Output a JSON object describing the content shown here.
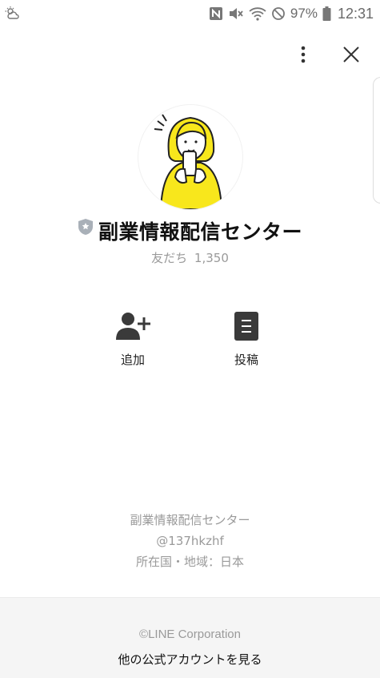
{
  "status_bar": {
    "battery": "97%",
    "time": "12:31",
    "icons": [
      "cloud-sun-icon",
      "nfc-icon",
      "mute-icon",
      "wifi-icon",
      "dnd-icon",
      "battery-icon"
    ]
  },
  "header": {
    "more_icon": "more-vertical-icon",
    "close_icon": "close-icon"
  },
  "profile": {
    "name": "副業情報配信センター",
    "badge_icon": "shield-badge-icon",
    "friends_label": "友だち",
    "friends_count": "1,350"
  },
  "actions": [
    {
      "label": "追加",
      "icon": "add-friend-icon"
    },
    {
      "label": "投稿",
      "icon": "post-icon"
    }
  ],
  "info": {
    "name": "副業情報配信センター",
    "id": "@137hkzhf",
    "region": "所在国・地域：日本"
  },
  "footer": {
    "copyright": "©LINE Corporation",
    "other_accounts": "他の公式アカウントを見る"
  },
  "colors": {
    "accent_yellow": "#F8E71C",
    "icon_dark": "#3a3a3a",
    "muted_text": "#9a9a9a",
    "footer_bg": "#f5f5f5"
  }
}
